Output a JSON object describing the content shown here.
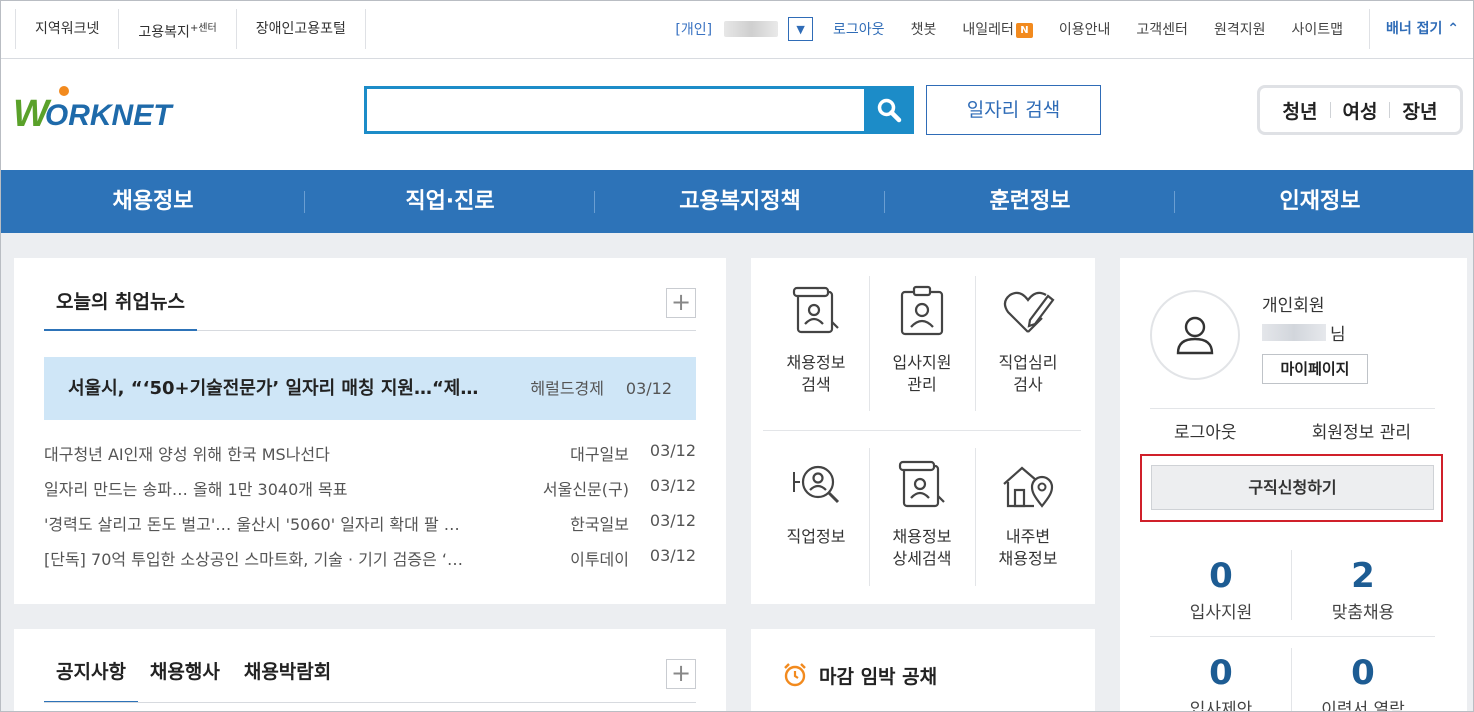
{
  "util_left": [
    "지역워크넷",
    "고용복지",
    "장애인고용포털"
  ],
  "util_left_sup": "+센터",
  "util_right": {
    "gaein": "[개인]",
    "logout": "로그아웃",
    "chatbot": "챗봇",
    "newsletter": "내일레터",
    "newsletter_badge": "N",
    "guide": "이용안내",
    "customer": "고객센터",
    "remote": "원격지원",
    "sitemap": "사이트맵",
    "fold": "배너 접기 ⌃"
  },
  "header": {
    "logo_w": "W",
    "logo_rest": "ORKNET",
    "search_placeholder": "",
    "job_search": "일자리 검색",
    "segments": [
      "청년",
      "여성",
      "장년"
    ]
  },
  "nav": [
    "채용정보",
    "직업·진로",
    "고용복지정책",
    "훈련정보",
    "인재정보"
  ],
  "news": {
    "title": "오늘의 취업뉴스",
    "headline": {
      "title": "서울시, “‘50+기술전문가’ 일자리 매칭 지원…“제…",
      "source": "헤럴드경제",
      "date": "03/12"
    },
    "items": [
      {
        "title": "대구청년 AI인재 양성 위해 한국 MS나선다",
        "source": "대구일보",
        "date": "03/12"
      },
      {
        "title": "일자리 만드는 송파… 올해 1만 3040개 목표",
        "source": "서울신문(구)",
        "date": "03/12"
      },
      {
        "title": "'경력도 살리고 돈도 벌고'… 울산시 '5060' 일자리 확대 팔 …",
        "source": "한국일보",
        "date": "03/12"
      },
      {
        "title": "[단독] 70억 투입한 소상공인 스마트화, 기술 · 기기 검증은 ‘…",
        "source": "이투데이",
        "date": "03/12"
      }
    ]
  },
  "notice_tabs": [
    "공지사항",
    "채용행사",
    "채용박람회"
  ],
  "icons": [
    {
      "line1": "채용정보",
      "line2": "검색"
    },
    {
      "line1": "입사지원",
      "line2": "관리"
    },
    {
      "line1": "직업심리",
      "line2": "검사"
    },
    {
      "line1": "직업정보",
      "line2": ""
    },
    {
      "line1": "채용정보",
      "line2": "상세검색"
    },
    {
      "line1": "내주변",
      "line2": "채용정보"
    }
  ],
  "deadline": {
    "title": "마감 임박 공채"
  },
  "user": {
    "type": "개인회원",
    "suffix": "님",
    "mypage": "마이페이지",
    "logout": "로그아웃",
    "profile": "회원정보 관리",
    "apply": "구직신청하기",
    "stats": [
      {
        "num": "0",
        "label": "입사지원"
      },
      {
        "num": "2",
        "label": "맞춤채용"
      },
      {
        "num": "0",
        "label": "입사제안"
      },
      {
        "num": "0",
        "label": "이력서 열람"
      }
    ]
  }
}
